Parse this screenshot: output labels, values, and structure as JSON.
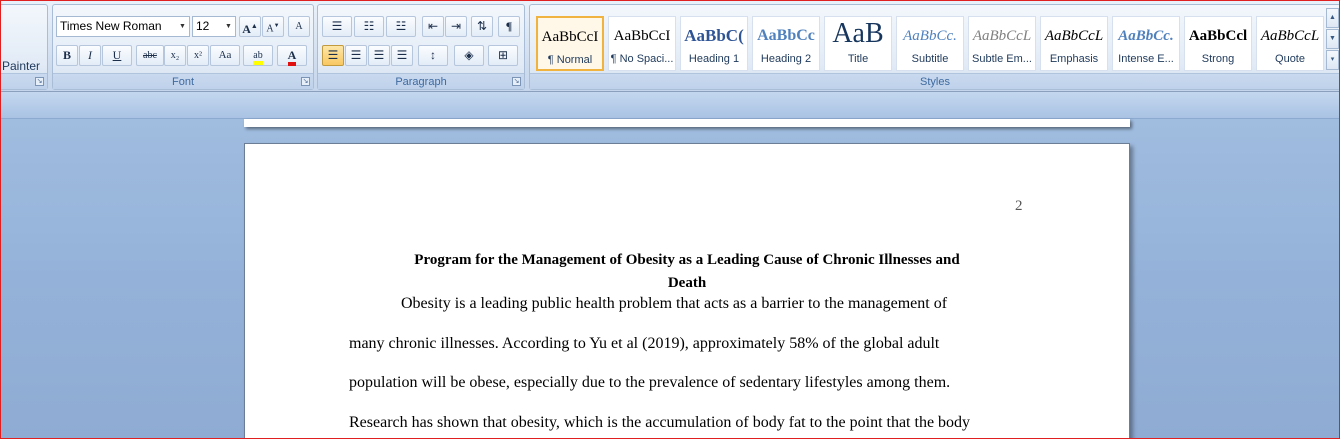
{
  "ribbon": {
    "clipboard": {
      "painter_label": "Painter"
    },
    "font": {
      "label": "Font",
      "font_name": "Times New Roman",
      "font_size": "12",
      "grow_glyph": "A",
      "shrink_glyph": "A",
      "clear_glyph": "A",
      "bold": "B",
      "italic": "I",
      "underline": "U",
      "strike": "abc",
      "subscript": "x₂",
      "superscript": "x²",
      "change_case": "Aa",
      "highlight": "ab",
      "font_color": "A"
    },
    "paragraph": {
      "label": "Paragraph",
      "bullets_glyph": "☰",
      "numbering_glyph": "☷",
      "multilevel_glyph": "☳",
      "decrease_indent_glyph": "⇤",
      "increase_indent_glyph": "⇥",
      "sort_glyph": "⇅",
      "show_marks_glyph": "¶",
      "align_left_glyph": "☰",
      "align_center_glyph": "☰",
      "align_right_glyph": "☰",
      "justify_glyph": "☰",
      "line_spacing_glyph": "↕",
      "shading_glyph": "◈",
      "borders_glyph": "⊞"
    },
    "styles": {
      "label": "Styles",
      "items": [
        {
          "sample": "AaBbCcI",
          "name": "¶ Normal"
        },
        {
          "sample": "AaBbCcI",
          "name": "¶ No Spaci..."
        },
        {
          "sample": "AaBbC(",
          "name": "Heading 1"
        },
        {
          "sample": "AaBbCc",
          "name": "Heading 2"
        },
        {
          "sample": "AaB",
          "name": "Title"
        },
        {
          "sample": "AaBbCc.",
          "name": "Subtitle"
        },
        {
          "sample": "AaBbCcL",
          "name": "Subtle Em..."
        },
        {
          "sample": "AaBbCcL",
          "name": "Emphasis"
        },
        {
          "sample": "AaBbCc.",
          "name": "Intense E..."
        },
        {
          "sample": "AaBbCcl",
          "name": "Strong"
        },
        {
          "sample": "AaBbCcL",
          "name": "Quote"
        }
      ]
    }
  },
  "colors": {
    "highlight": "#ffff00",
    "font_color": "#e01010",
    "heading_blue": "#2f5496"
  },
  "document": {
    "page_number": "2",
    "title_line1": "Program for the Management of Obesity as a Leading Cause of Chronic Illnesses and",
    "title_line2": "Death",
    "lines": [
      "Obesity is a leading public health problem that acts as a barrier to the management of",
      "many chronic illnesses. According to Yu et al (2019), approximately 58% of the global adult",
      "population will be obese, especially due to the prevalence of sedentary lifestyles among them.",
      "Research has shown that obesity, which is the accumulation of body fat to the point that the body"
    ]
  }
}
